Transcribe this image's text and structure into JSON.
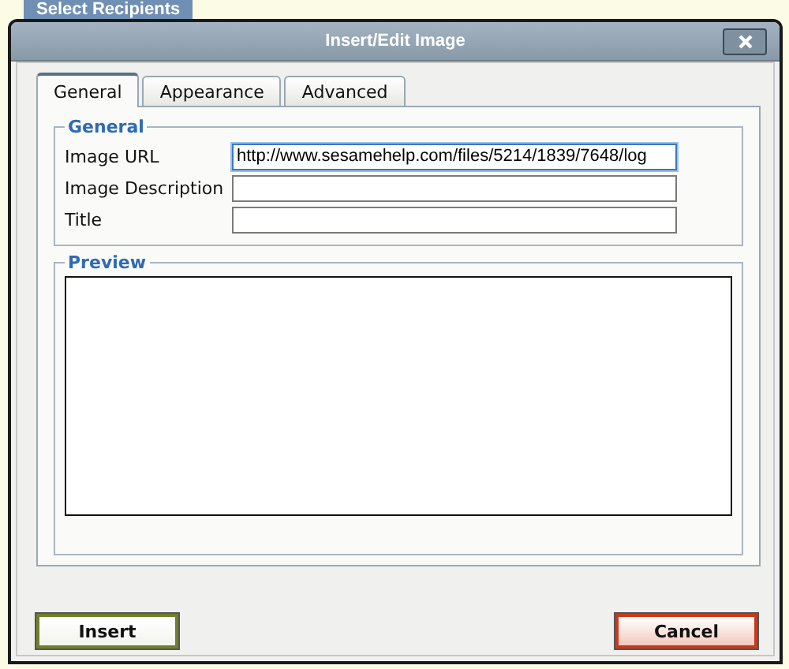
{
  "background": {
    "banner": "Select Recipients"
  },
  "window": {
    "title": "Insert/Edit Image"
  },
  "tabs": [
    {
      "label": "General",
      "selected": true
    },
    {
      "label": "Appearance",
      "selected": false
    },
    {
      "label": "Advanced",
      "selected": false
    }
  ],
  "general": {
    "legend": "General",
    "fields": [
      {
        "label": "Image URL",
        "value": "http://www.sesamehelp.com/files/5214/1839/7648/log",
        "focused": true
      },
      {
        "label": "Image Description",
        "focused": false
      },
      {
        "label": "Title",
        "focused": false
      }
    ]
  },
  "preview": {
    "legend": "Preview"
  },
  "buttons": [
    {
      "label": "Insert",
      "kind": "confirm"
    },
    {
      "label": "Cancel",
      "kind": "cancel"
    }
  ]
}
